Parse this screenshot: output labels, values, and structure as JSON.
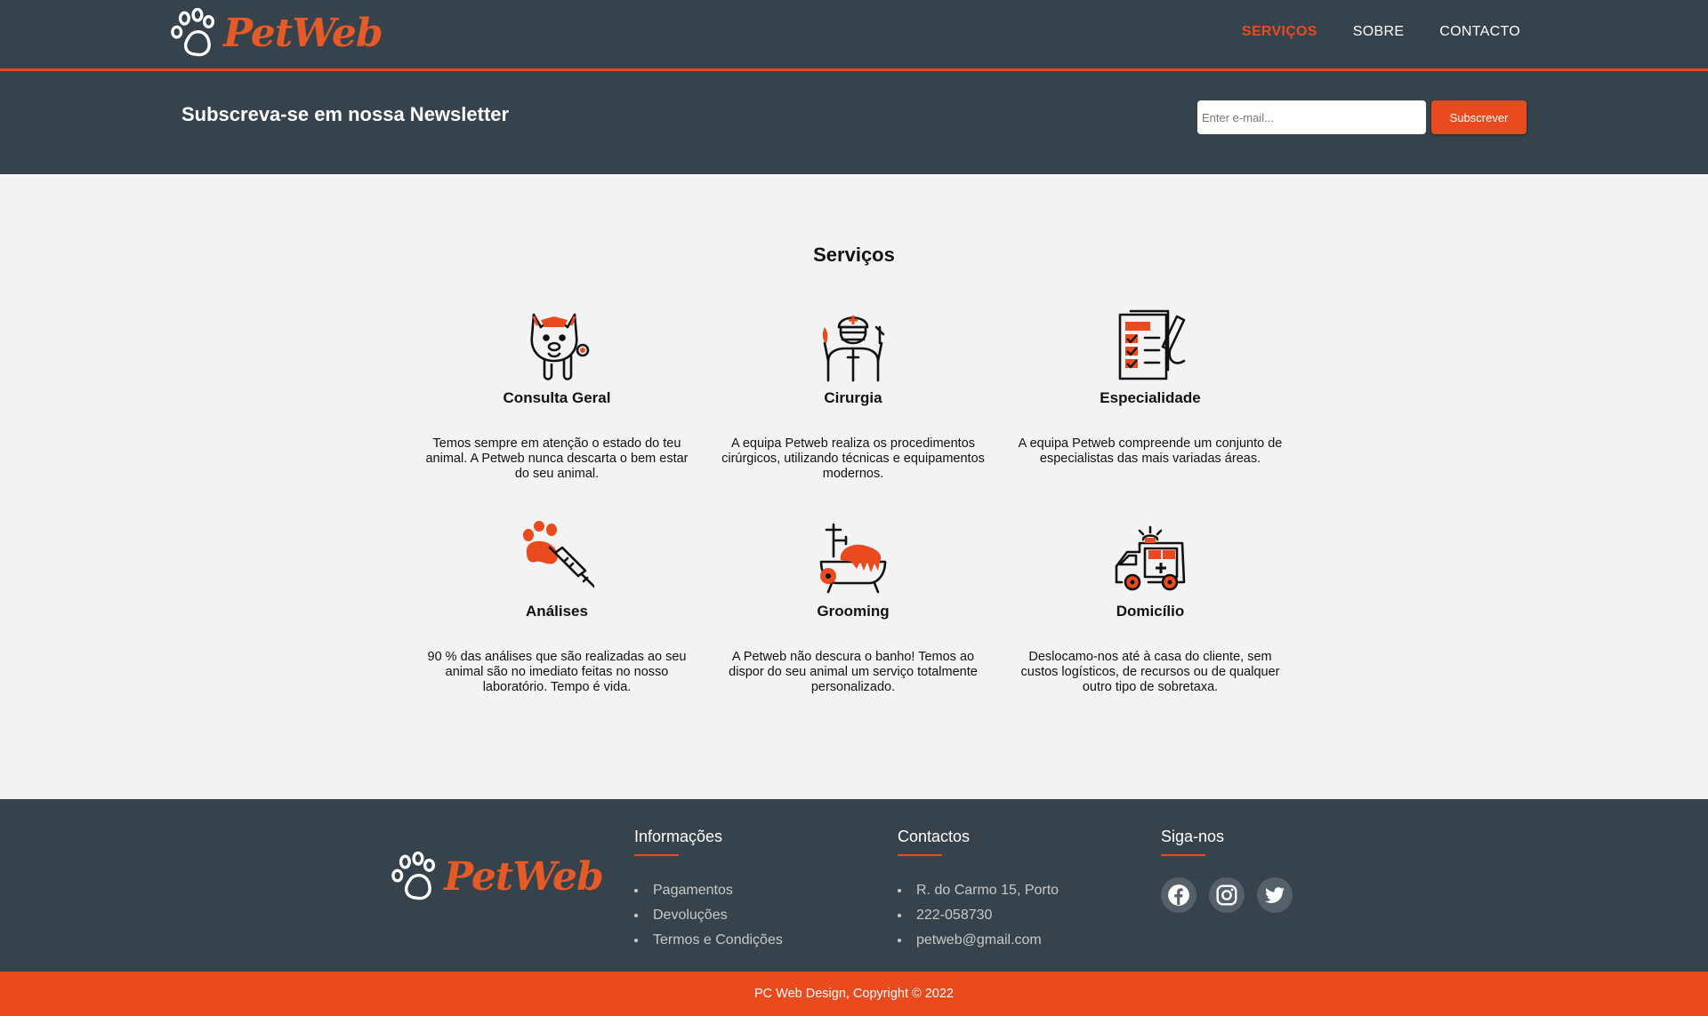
{
  "brand": {
    "name": "PetWeb",
    "color": "#e55a26",
    "logo_icon": "paw-icon"
  },
  "nav": {
    "items": [
      {
        "label": "SERVIÇOS",
        "active": true
      },
      {
        "label": "SOBRE",
        "active": false
      },
      {
        "label": "CONTACTO",
        "active": false
      }
    ]
  },
  "newsletter": {
    "title": "Subscreva-se em nossa Newsletter",
    "email_placeholder": "Enter e-mail...",
    "email_value": "",
    "button_label": "Subscrever"
  },
  "services": {
    "title": "Serviços",
    "items": [
      {
        "name": "Consulta Geral",
        "icon": "dog-stethoscope-icon",
        "description": "Temos sempre em atenção o estado do teu animal. A Petweb nunca descarta o bem estar do seu animal."
      },
      {
        "name": "Cirurgia",
        "icon": "surgeon-icon",
        "description": "A equipa Petweb realiza os procedimentos cirúrgicos, utilizando técnicas e equipamentos modernos."
      },
      {
        "name": "Especialidade",
        "icon": "clipboard-checklist-icon",
        "description": "A equipa Petweb compreende um conjunto de especialistas das mais variadas áreas."
      },
      {
        "name": "Análises",
        "icon": "paw-syringe-icon",
        "description": "90 % das análises que são realizadas ao seu animal são no imediato feitas no nosso laboratório. Tempo é vida."
      },
      {
        "name": "Grooming",
        "icon": "pet-bath-icon",
        "description": "A Petweb não descura o banho! Temos ao dispor do seu animal um serviço totalmente personalizado."
      },
      {
        "name": "Domicílio",
        "icon": "ambulance-icon",
        "description": "Deslocamo-nos até à casa do cliente, sem custos logísticos, de recursos ou de qualquer outro tipo de sobretaxa."
      }
    ]
  },
  "footer": {
    "info": {
      "title": "Informações",
      "links": [
        "Pagamentos",
        "Devoluções",
        "Termos e Condições"
      ]
    },
    "contacts": {
      "title": "Contactos",
      "items": [
        "R. do Carmo 15, Porto",
        "222-058730",
        "petweb@gmail.com"
      ]
    },
    "social": {
      "title": "Siga-nos",
      "icons": [
        "facebook-icon",
        "instagram-icon",
        "twitter-icon"
      ]
    },
    "copyright": "PC Web Design, Copyright © 2022"
  },
  "colors": {
    "dark": "#36434c",
    "accent": "#e94b1f",
    "background": "#f3f3f3"
  }
}
